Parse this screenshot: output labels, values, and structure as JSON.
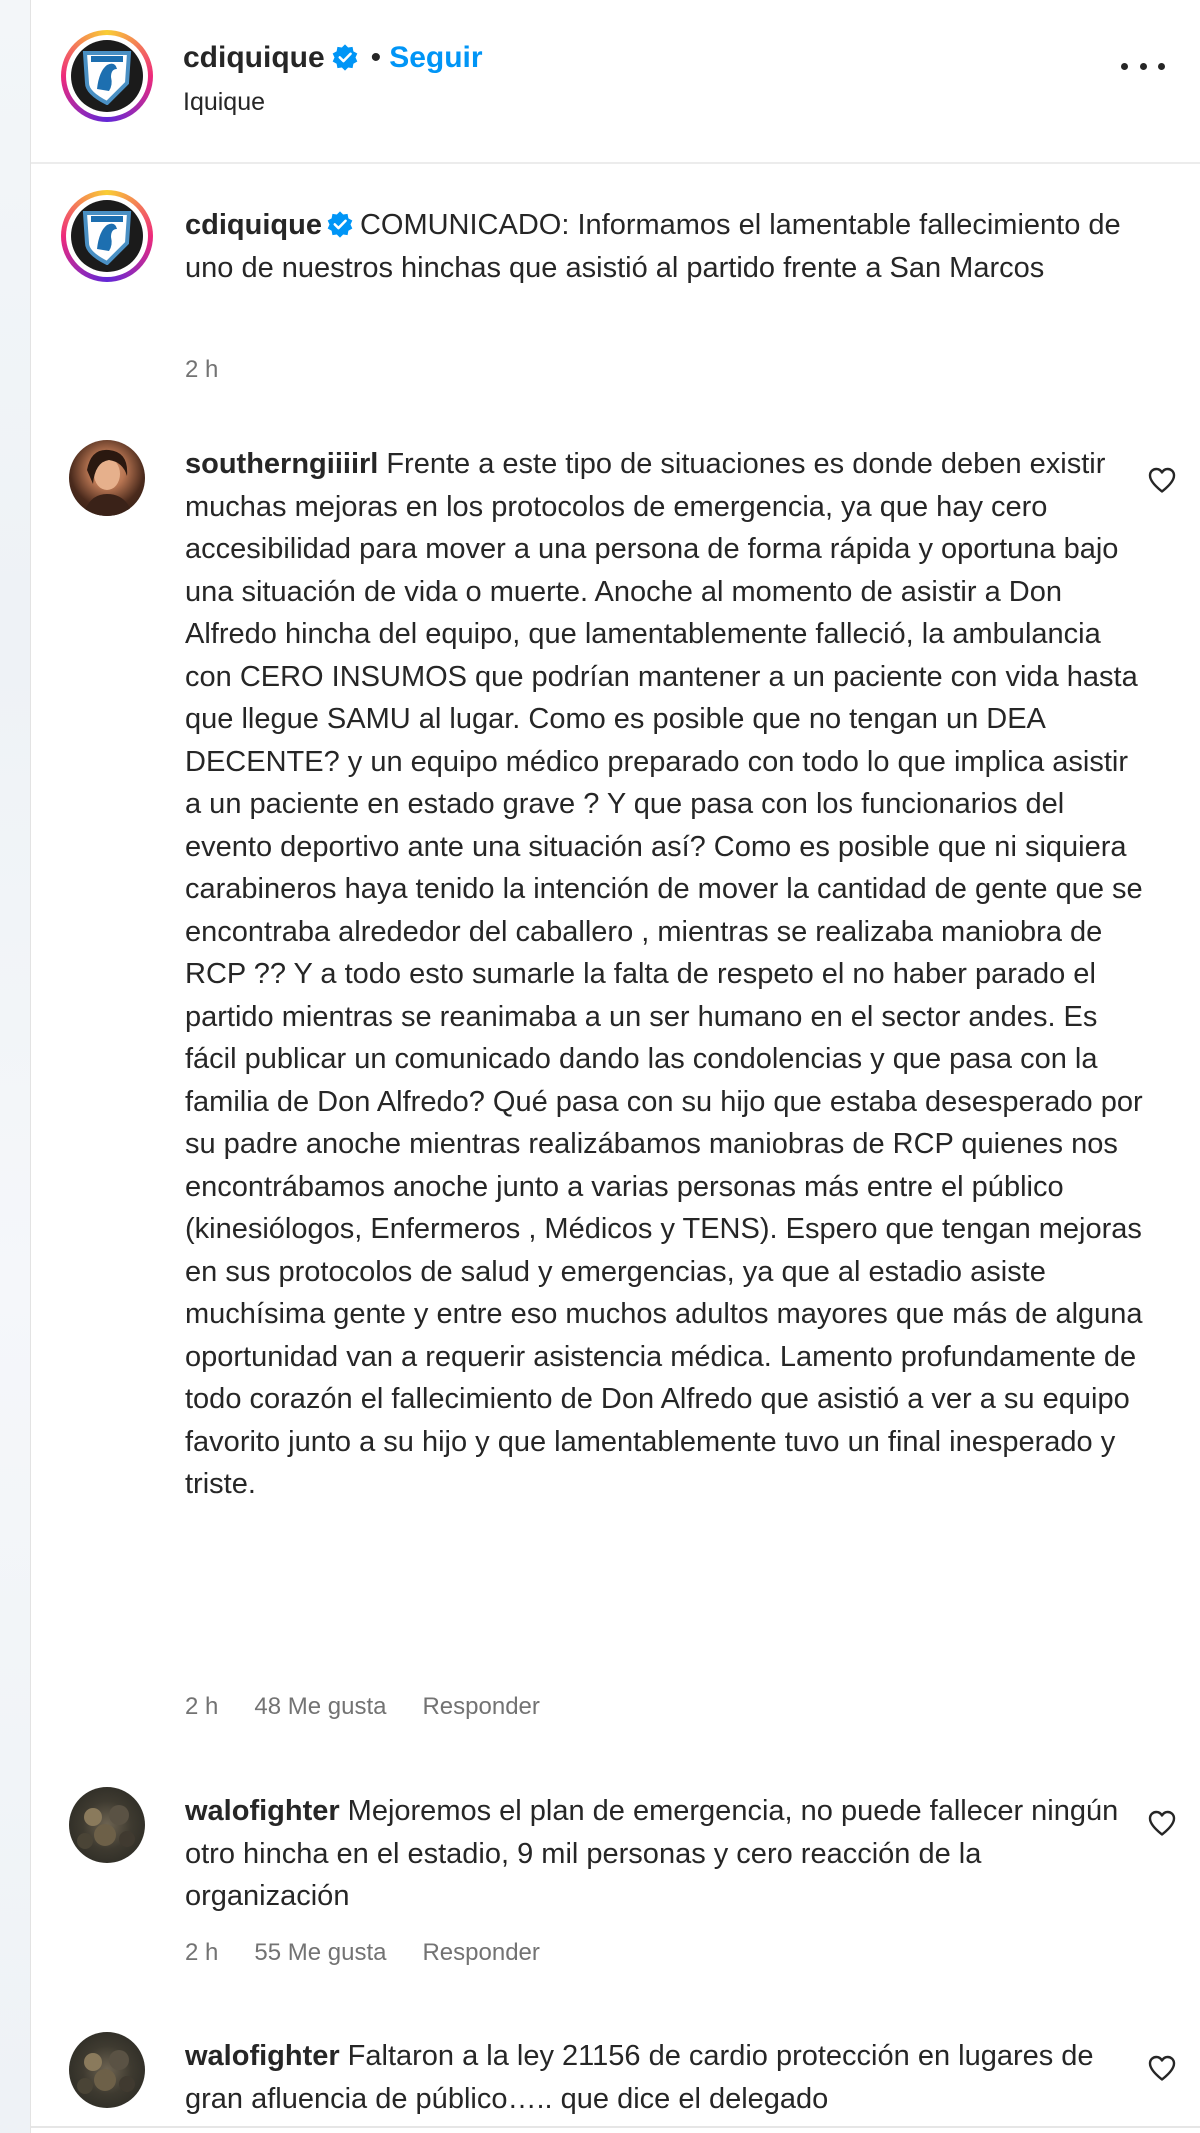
{
  "post_header": {
    "username": "cdiquique",
    "separator": "•",
    "follow_label": "Seguir",
    "location": "Iquique"
  },
  "caption": {
    "username": "cdiquique",
    "text": "COMUNICADO: Informamos el lamentable fallecimiento de uno de nuestros hinchas que asistió al partido frente a San Marcos",
    "time": "2 h"
  },
  "comments": [
    {
      "username": "southerngiiiirl",
      "text": "Frente a este tipo de situaciones es donde deben existir muchas mejoras en los protocolos de emergencia, ya que hay cero accesibilidad para mover a una persona de forma rápida y oportuna bajo una situación de vida o muerte. Anoche al momento de asistir a Don Alfredo hincha del equipo, que lamentablemente falleció, la ambulancia con CERO INSUMOS que podrían mantener a un paciente con vida hasta que llegue SAMU al lugar. Como es posible que no tengan un DEA DECENTE? y un equipo médico preparado con todo lo que implica asistir a un paciente en estado grave ? Y que pasa con los funcionarios del evento deportivo ante una situación así? Como es posible que ni siquiera carabineros haya tenido la intención de mover la cantidad de gente que se encontraba alrededor del caballero , mientras se realizaba maniobra de RCP ?? Y a todo esto sumarle la falta de respeto el no haber parado el partido mientras se reanimaba a un ser humano en el sector andes. Es fácil publicar un comunicado dando las condolencias y que pasa con la familia de Don Alfredo? Qué pasa con su hijo que estaba desesperado por su padre anoche mientras realizábamos maniobras de RCP quienes nos encontrábamos anoche junto a varias personas más entre el público (kinesiólogos, Enfermeros , Médicos y TENS). Espero que tengan mejoras en sus protocolos de salud y emergencias, ya que al estadio asiste muchísima gente y entre eso muchos adultos mayores que más de alguna oportunidad van a requerir asistencia médica. Lamento profundamente de todo corazón el fallecimiento de Don Alfredo que asistió a ver a su equipo favorito junto a su hijo y que lamentablemente tuvo un final inesperado y triste.",
      "time": "2 h",
      "likes": "48 Me gusta",
      "reply": "Responder"
    },
    {
      "username": "walofighter",
      "text": "Mejoremos el plan de emergencia, no puede fallecer ningún otro hincha en el estadio, 9 mil personas y cero reacción de la organización",
      "time": "2 h",
      "likes": "55 Me gusta",
      "reply": "Responder"
    },
    {
      "username": "walofighter",
      "text": "Faltaron a la ley 21156 de cardio protección en lugares de gran afluencia de público….. que dice el delegado"
    }
  ],
  "icons": {
    "verified": "verified-badge-icon",
    "more": "more-options-icon",
    "heart": "heart-outline-icon"
  },
  "colors": {
    "link_blue": "#0095f6",
    "verified_blue": "#0095f6",
    "meta_gray": "#737373",
    "text": "#262626"
  }
}
